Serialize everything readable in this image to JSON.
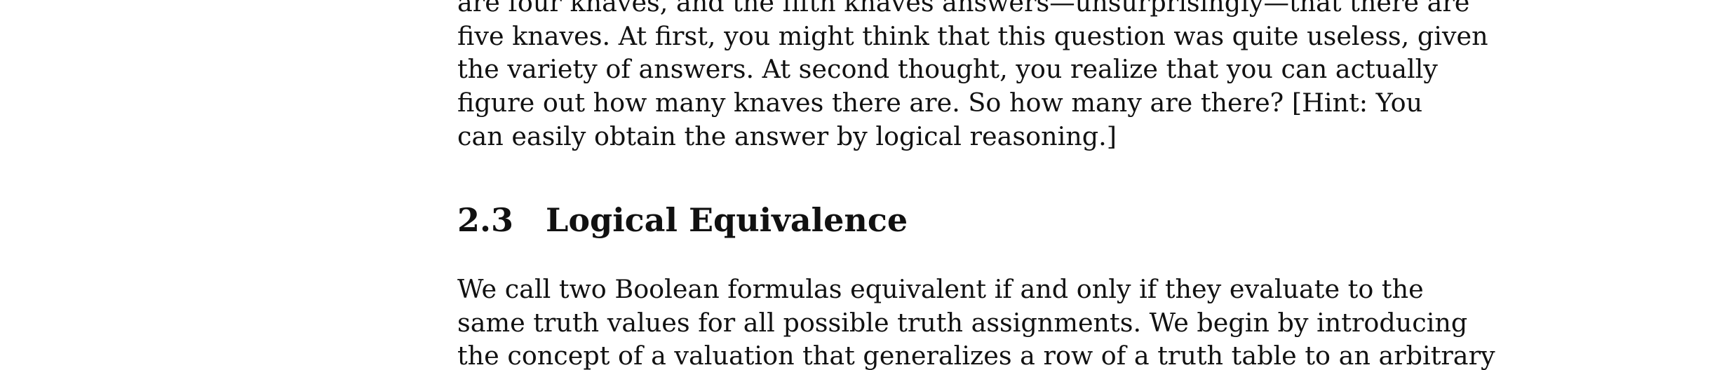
{
  "paragraph_top": {
    "lines": [
      "are four knaves, and the fifth knaves answers—unsurprisingly—that there are",
      "five knaves. At first, you might think that this question was quite useless, given",
      "the variety of answers. At second thought, you realize that you can actually",
      "figure out how many knaves there are. So how many are there? [Hint: You",
      "can easily obtain the answer by logical reasoning.]"
    ]
  },
  "section": {
    "number": "2.3",
    "title": "Logical Equivalence"
  },
  "paragraph_bottom": {
    "lines": [
      "We call two Boolean formulas equivalent if and only if they evaluate to the",
      "same truth values for all possible truth assignments. We begin by introducing",
      "the concept of a valuation that generalizes a row of a truth table to an arbitrary"
    ]
  }
}
